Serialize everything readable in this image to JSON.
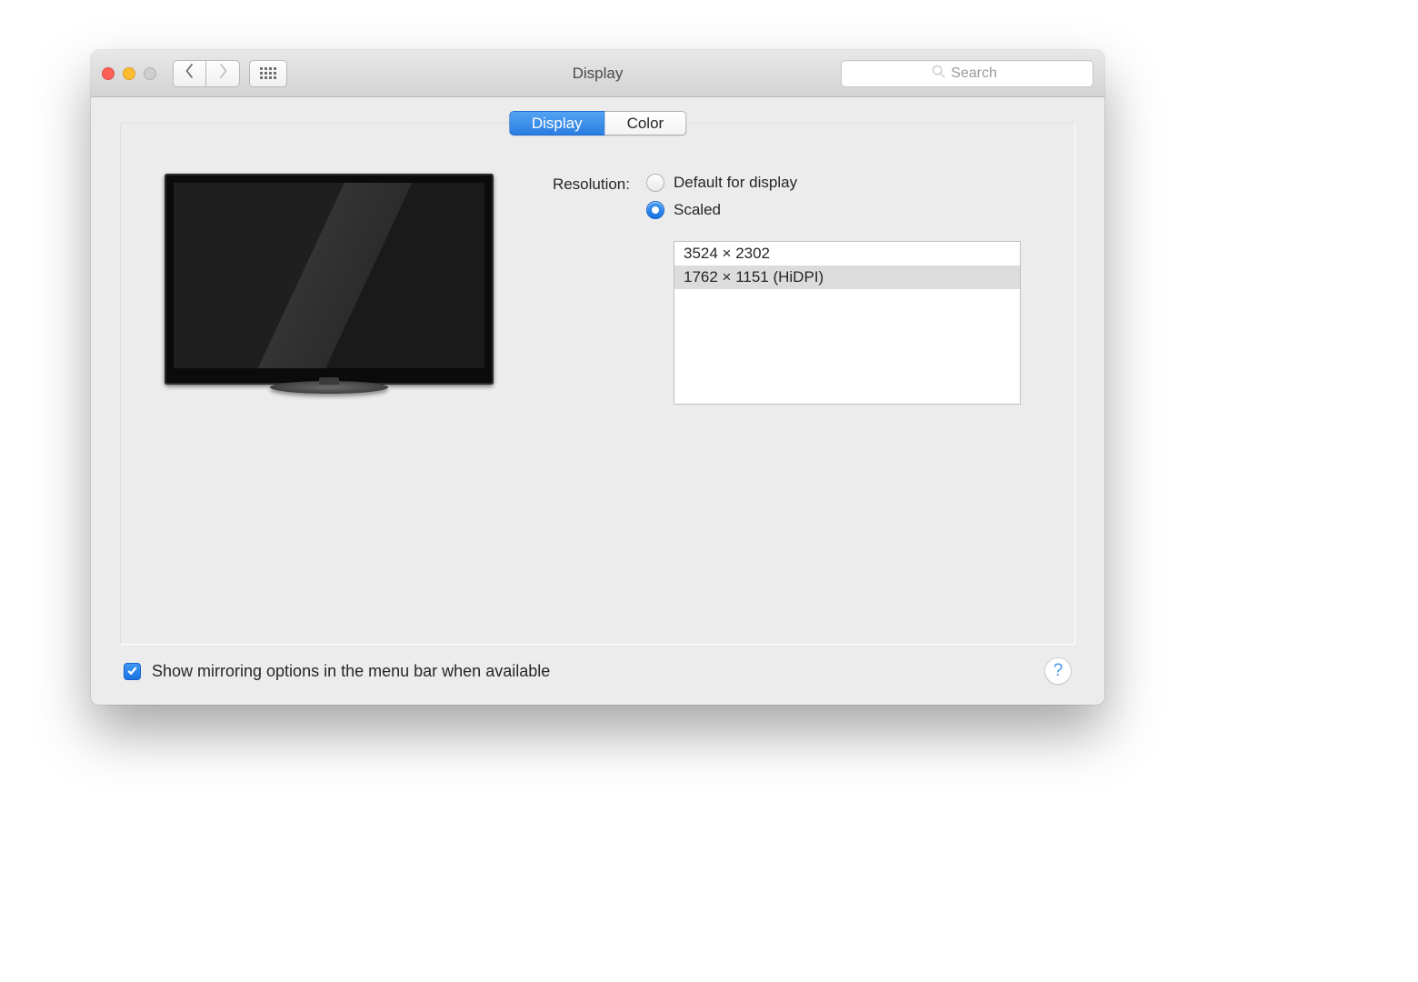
{
  "window": {
    "title": "Display"
  },
  "search": {
    "placeholder": "Search"
  },
  "tabs": {
    "display": "Display",
    "color": "Color",
    "active": "display"
  },
  "resolution": {
    "label": "Resolution:",
    "default_label": "Default for display",
    "scaled_label": "Scaled",
    "selected": "scaled",
    "options": [
      "3524 × 2302",
      "1762 × 1151 (HiDPI)"
    ],
    "selected_index": 1
  },
  "footer": {
    "mirroring_label": "Show mirroring options in the menu bar when available",
    "mirroring_checked": true
  },
  "help": {
    "label": "?"
  }
}
